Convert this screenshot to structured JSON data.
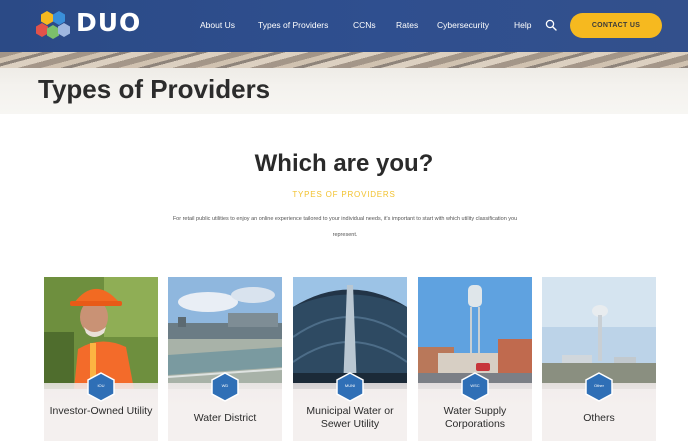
{
  "nav": {
    "logo_text": "DUO",
    "logo_tagline": "DUO",
    "links": [
      "About Us",
      "Types of Providers",
      "CCNs",
      "Rates",
      "Cybersecurity",
      "Help"
    ],
    "contact_label": "CONTACT US",
    "icons": {
      "search": "search-icon",
      "logo": "hexagon-cluster-logo"
    },
    "colors": {
      "bar": "#2f4f8f",
      "accent": "#f6b91f"
    }
  },
  "hero": {
    "title": "Types of Providers"
  },
  "main": {
    "heading": "Which are you?",
    "subheading": "TYPES OF PROVIDERS",
    "intro": "For retail public utilities to enjoy an online experience tailored to your individual needs, it's important to start with which utility classification you represent."
  },
  "cards": [
    {
      "label": "Investor-Owned Utility",
      "badge": "IOU"
    },
    {
      "label": "Water District",
      "badge": "WD"
    },
    {
      "label": "Municipal Water or Sewer Utility",
      "badge": "MUNI"
    },
    {
      "label": "Water Supply Corporations",
      "badge": "WSC"
    },
    {
      "label": "Others",
      "badge": "Other"
    }
  ]
}
